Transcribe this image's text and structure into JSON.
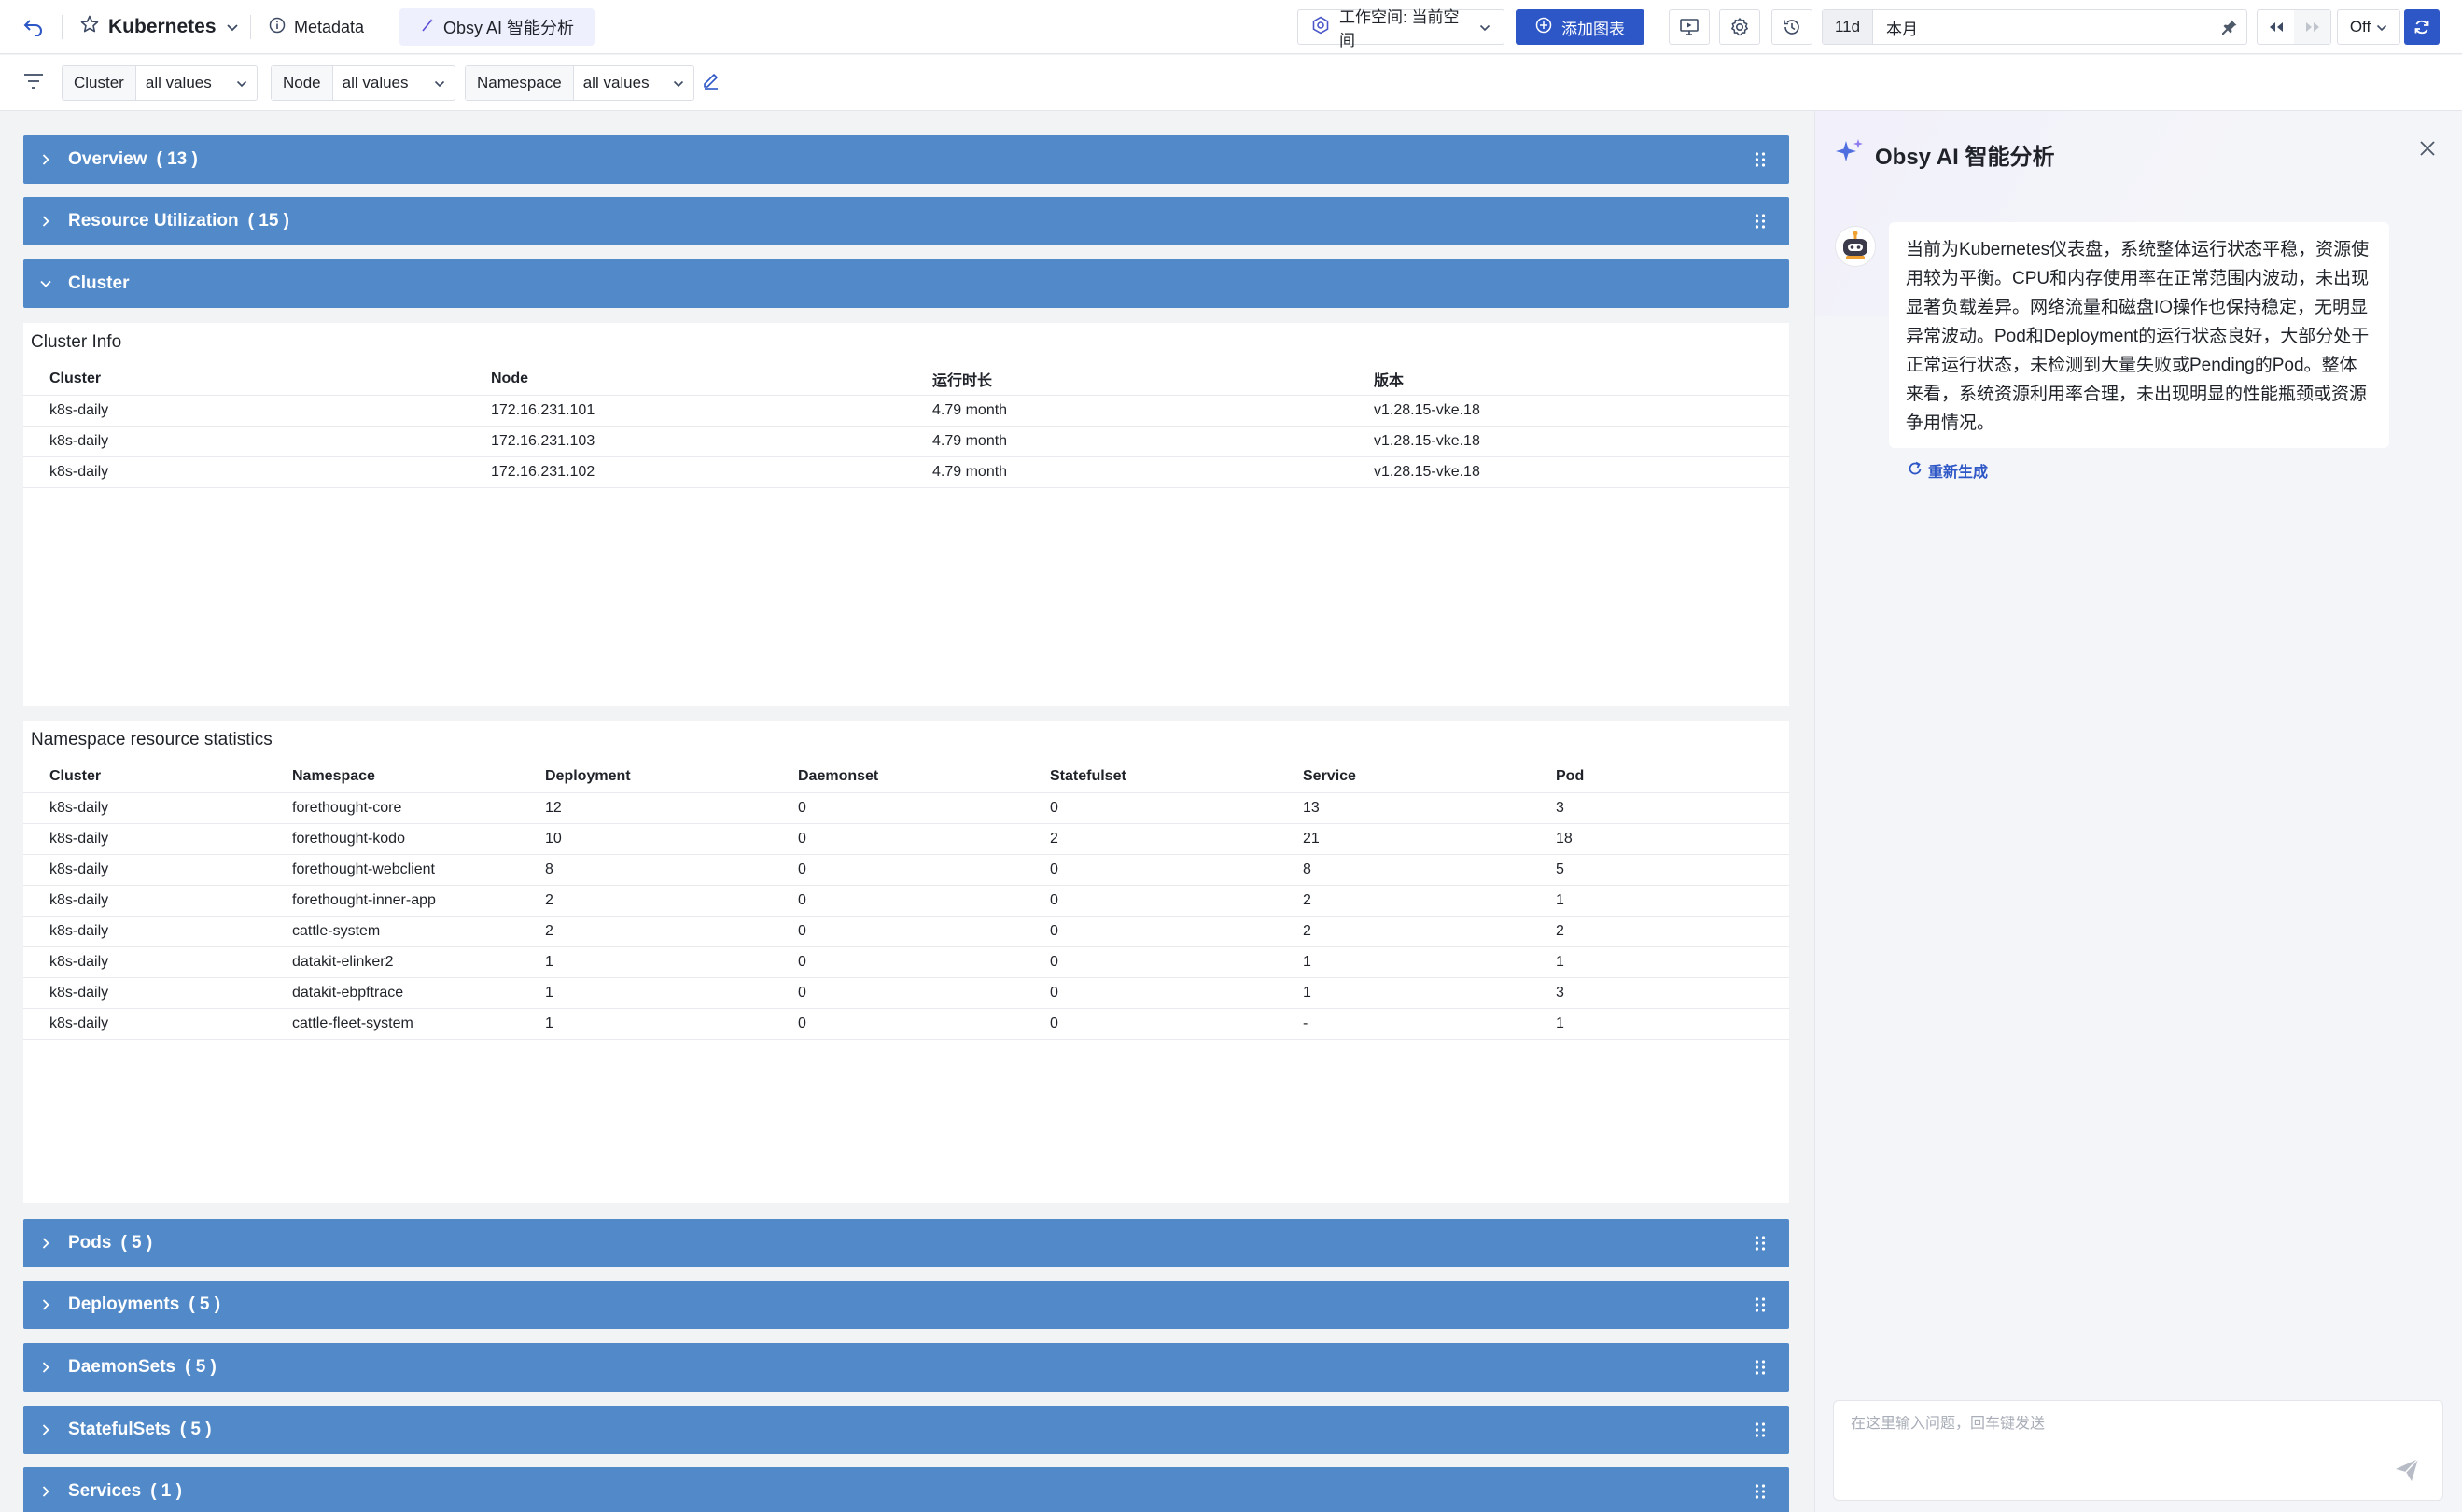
{
  "toolbar": {
    "dashboard_title": "Kubernetes",
    "metadata_tab": "Metadata",
    "ai_tab": "Obsy AI 智能分析",
    "workspace_label": "工作空间: 当前空间",
    "add_chart_label": "添加图表",
    "time_quick": "11d",
    "time_value": "本月",
    "auto_refresh": "Off"
  },
  "filters": [
    {
      "label": "Cluster",
      "value": "all values"
    },
    {
      "label": "Node",
      "value": "all values"
    },
    {
      "label": "Namespace",
      "value": "all values"
    }
  ],
  "groups": {
    "overview": {
      "name": "Overview",
      "count": "( 13 )"
    },
    "resource": {
      "name": "Resource Utilization",
      "count": "( 15 )"
    },
    "cluster": {
      "name": "Cluster"
    },
    "pods": {
      "name": "Pods",
      "count": "( 5 )"
    },
    "deployments": {
      "name": "Deployments",
      "count": "( 5 )"
    },
    "daemonsets": {
      "name": "DaemonSets",
      "count": "( 5 )"
    },
    "statefulsets": {
      "name": "StatefulSets",
      "count": "( 5 )"
    },
    "services": {
      "name": "Services",
      "count": "( 1 )"
    }
  },
  "cluster_info": {
    "title": "Cluster Info",
    "columns": [
      "Cluster",
      "Node",
      "运行时长",
      "版本"
    ],
    "rows": [
      [
        "k8s-daily",
        "172.16.231.101",
        "4.79 month",
        "v1.28.15-vke.18"
      ],
      [
        "k8s-daily",
        "172.16.231.103",
        "4.79 month",
        "v1.28.15-vke.18"
      ],
      [
        "k8s-daily",
        "172.16.231.102",
        "4.79 month",
        "v1.28.15-vke.18"
      ]
    ]
  },
  "namespace_stats": {
    "title": "Namespace resource statistics",
    "columns": [
      "Cluster",
      "Namespace",
      "Deployment",
      "Daemonset",
      "Statefulset",
      "Service",
      "Pod"
    ],
    "rows": [
      [
        "k8s-daily",
        "forethought-core",
        "12",
        "0",
        "0",
        "13",
        "3"
      ],
      [
        "k8s-daily",
        "forethought-kodo",
        "10",
        "0",
        "2",
        "21",
        "18"
      ],
      [
        "k8s-daily",
        "forethought-webclient",
        "8",
        "0",
        "0",
        "8",
        "5"
      ],
      [
        "k8s-daily",
        "forethought-inner-app",
        "2",
        "0",
        "0",
        "2",
        "1"
      ],
      [
        "k8s-daily",
        "cattle-system",
        "2",
        "0",
        "0",
        "2",
        "2"
      ],
      [
        "k8s-daily",
        "datakit-elinker2",
        "1",
        "0",
        "0",
        "1",
        "1"
      ],
      [
        "k8s-daily",
        "datakit-ebpftrace",
        "1",
        "0",
        "0",
        "1",
        "3"
      ],
      [
        "k8s-daily",
        "cattle-fleet-system",
        "1",
        "0",
        "0",
        "-",
        "1"
      ]
    ]
  },
  "ai": {
    "title": "Obsy AI 智能分析",
    "message": "当前为Kubernetes仪表盘，系统整体运行状态平稳，资源使用较为平衡。CPU和内存使用率在正常范围内波动，未出现显著负载差异。网络流量和磁盘IO操作也保持稳定，无明显异常波动。Pod和Deployment的运行状态良好，大部分处于正常运行状态，未检测到大量失败或Pending的Pod。整体来看，系统资源利用率合理，未出现明显的性能瓶颈或资源争用情况。",
    "regenerate": "重新生成",
    "input_placeholder": "在这里输入问题，回车键发送"
  },
  "colors": {
    "group_header": "#5189c9",
    "primary": "#2d56c6"
  }
}
